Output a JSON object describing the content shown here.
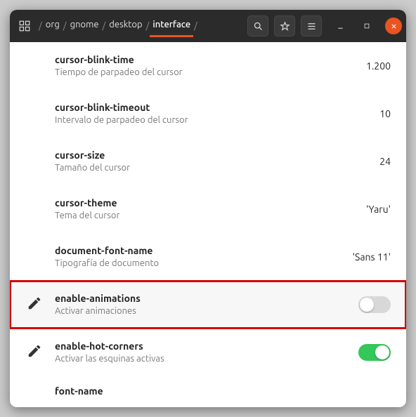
{
  "breadcrumb": {
    "segments": [
      "org",
      "gnome",
      "desktop",
      "interface"
    ],
    "active_index": 3
  },
  "rows": [
    {
      "key": "cursor-blink-time",
      "desc": "Tiempo de parpadeo del cursor",
      "value": "1.200",
      "edited": false,
      "toggle": null
    },
    {
      "key": "cursor-blink-timeout",
      "desc": "Intervalo de parpadeo del cursor",
      "value": "10",
      "edited": false,
      "toggle": null
    },
    {
      "key": "cursor-size",
      "desc": "Tamaño del cursor",
      "value": "24",
      "edited": false,
      "toggle": null
    },
    {
      "key": "cursor-theme",
      "desc": "Tema del cursor",
      "value": "'Yaru'",
      "edited": false,
      "toggle": null
    },
    {
      "key": "document-font-name",
      "desc": "Tipografía de documento",
      "value": "'Sans 11'",
      "edited": false,
      "toggle": null
    },
    {
      "key": "enable-animations",
      "desc": "Activar animaciones",
      "value": null,
      "edited": true,
      "toggle": false,
      "highlight": true
    },
    {
      "key": "enable-hot-corners",
      "desc": "Activar las esquinas activas",
      "value": null,
      "edited": true,
      "toggle": true
    },
    {
      "key": "font-name",
      "desc": "",
      "value": "",
      "edited": false,
      "toggle": null,
      "cutoff": true
    }
  ],
  "icons": {
    "app": "dconf-icon",
    "search": "search-icon",
    "star": "star-icon",
    "menu": "hamburger-icon",
    "minimize": "minimize-icon",
    "maximize": "maximize-icon",
    "close": "close-icon",
    "modified": "pencil-icon"
  }
}
